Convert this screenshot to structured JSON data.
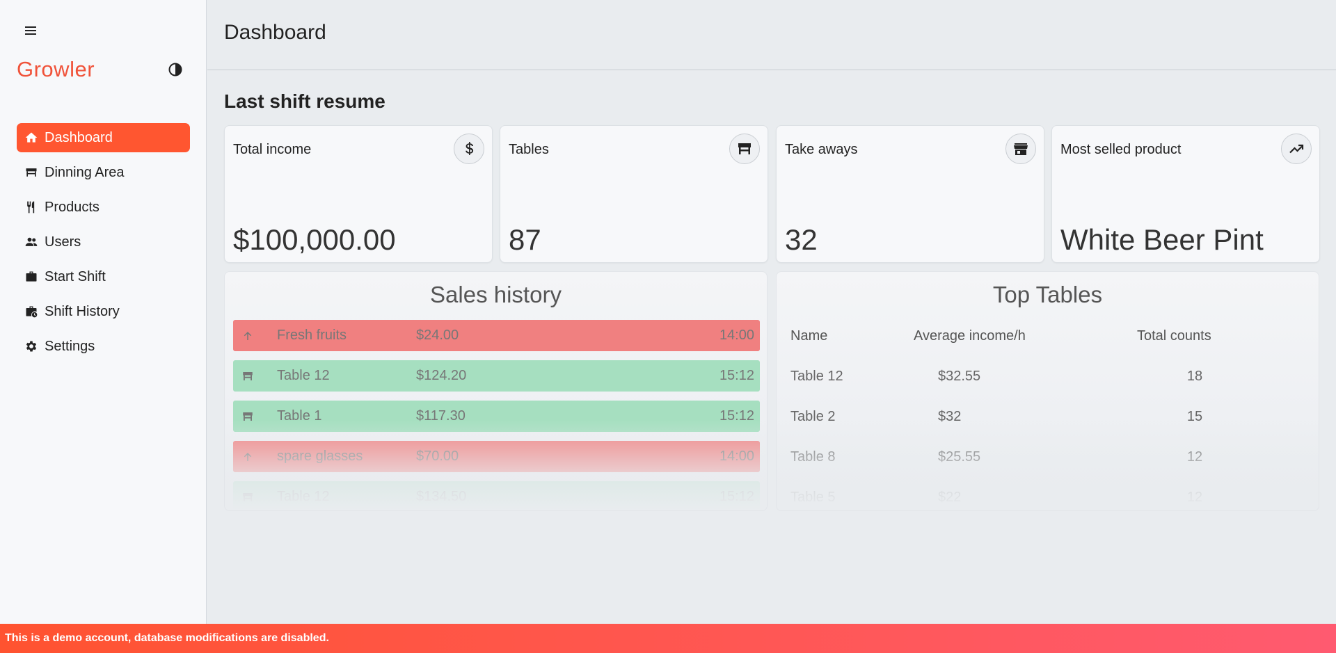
{
  "app": {
    "brand": "Growler"
  },
  "sidebar": {
    "items": [
      {
        "label": "Dashboard",
        "icon": "home-icon",
        "active": true
      },
      {
        "label": "Dinning Area",
        "icon": "table-icon"
      },
      {
        "label": "Products",
        "icon": "utensils-icon"
      },
      {
        "label": "Users",
        "icon": "users-icon"
      },
      {
        "label": "Start Shift",
        "icon": "briefcase-icon"
      },
      {
        "label": "Shift History",
        "icon": "briefcase-clock-icon"
      },
      {
        "label": "Settings",
        "icon": "gear-icon"
      }
    ]
  },
  "header": {
    "title": "Dashboard"
  },
  "main": {
    "section_title": "Last shift resume",
    "stats": [
      {
        "label": "Total income",
        "value": "$100,000.00",
        "icon": "dollar-icon"
      },
      {
        "label": "Tables",
        "value": "87",
        "icon": "table-icon"
      },
      {
        "label": "Take aways",
        "value": "32",
        "icon": "store-icon"
      },
      {
        "label": "Most selled product",
        "value": "White Beer Pint",
        "icon": "trending-up-icon"
      }
    ],
    "sales_history": {
      "title": "Sales history",
      "rows": [
        {
          "type": "expense",
          "icon": "arrow-up-icon",
          "name": "Fresh fruits",
          "amount": "$24.00",
          "time": "14:00"
        },
        {
          "type": "income",
          "icon": "table-icon",
          "name": "Table 12",
          "amount": "$124.20",
          "time": "15:12"
        },
        {
          "type": "income",
          "icon": "table-icon",
          "name": "Table 1",
          "amount": "$117.30",
          "time": "15:12"
        },
        {
          "type": "expense",
          "icon": "arrow-up-icon",
          "name": "spare glasses",
          "amount": "$70.00",
          "time": "14:00"
        },
        {
          "type": "income",
          "icon": "table-icon",
          "name": "Table 12",
          "amount": "$134.50",
          "time": "15:12"
        }
      ]
    },
    "top_tables": {
      "title": "Top Tables",
      "columns": [
        "Name",
        "Average income/h",
        "Total counts"
      ],
      "rows": [
        {
          "name": "Table 12",
          "avg": "$32.55",
          "count": "18"
        },
        {
          "name": "Table 2",
          "avg": "$32",
          "count": "15"
        },
        {
          "name": "Table 8",
          "avg": "$25.55",
          "count": "12"
        },
        {
          "name": "Table 5",
          "avg": "$22",
          "count": "12"
        }
      ]
    }
  },
  "footer": {
    "demo_notice": "This is a demo account, database modifications are disabled."
  },
  "colors": {
    "accent": "#ff5630",
    "brand": "#f0533a",
    "expense_row": "#f08080",
    "income_row": "#a6dfc0"
  }
}
